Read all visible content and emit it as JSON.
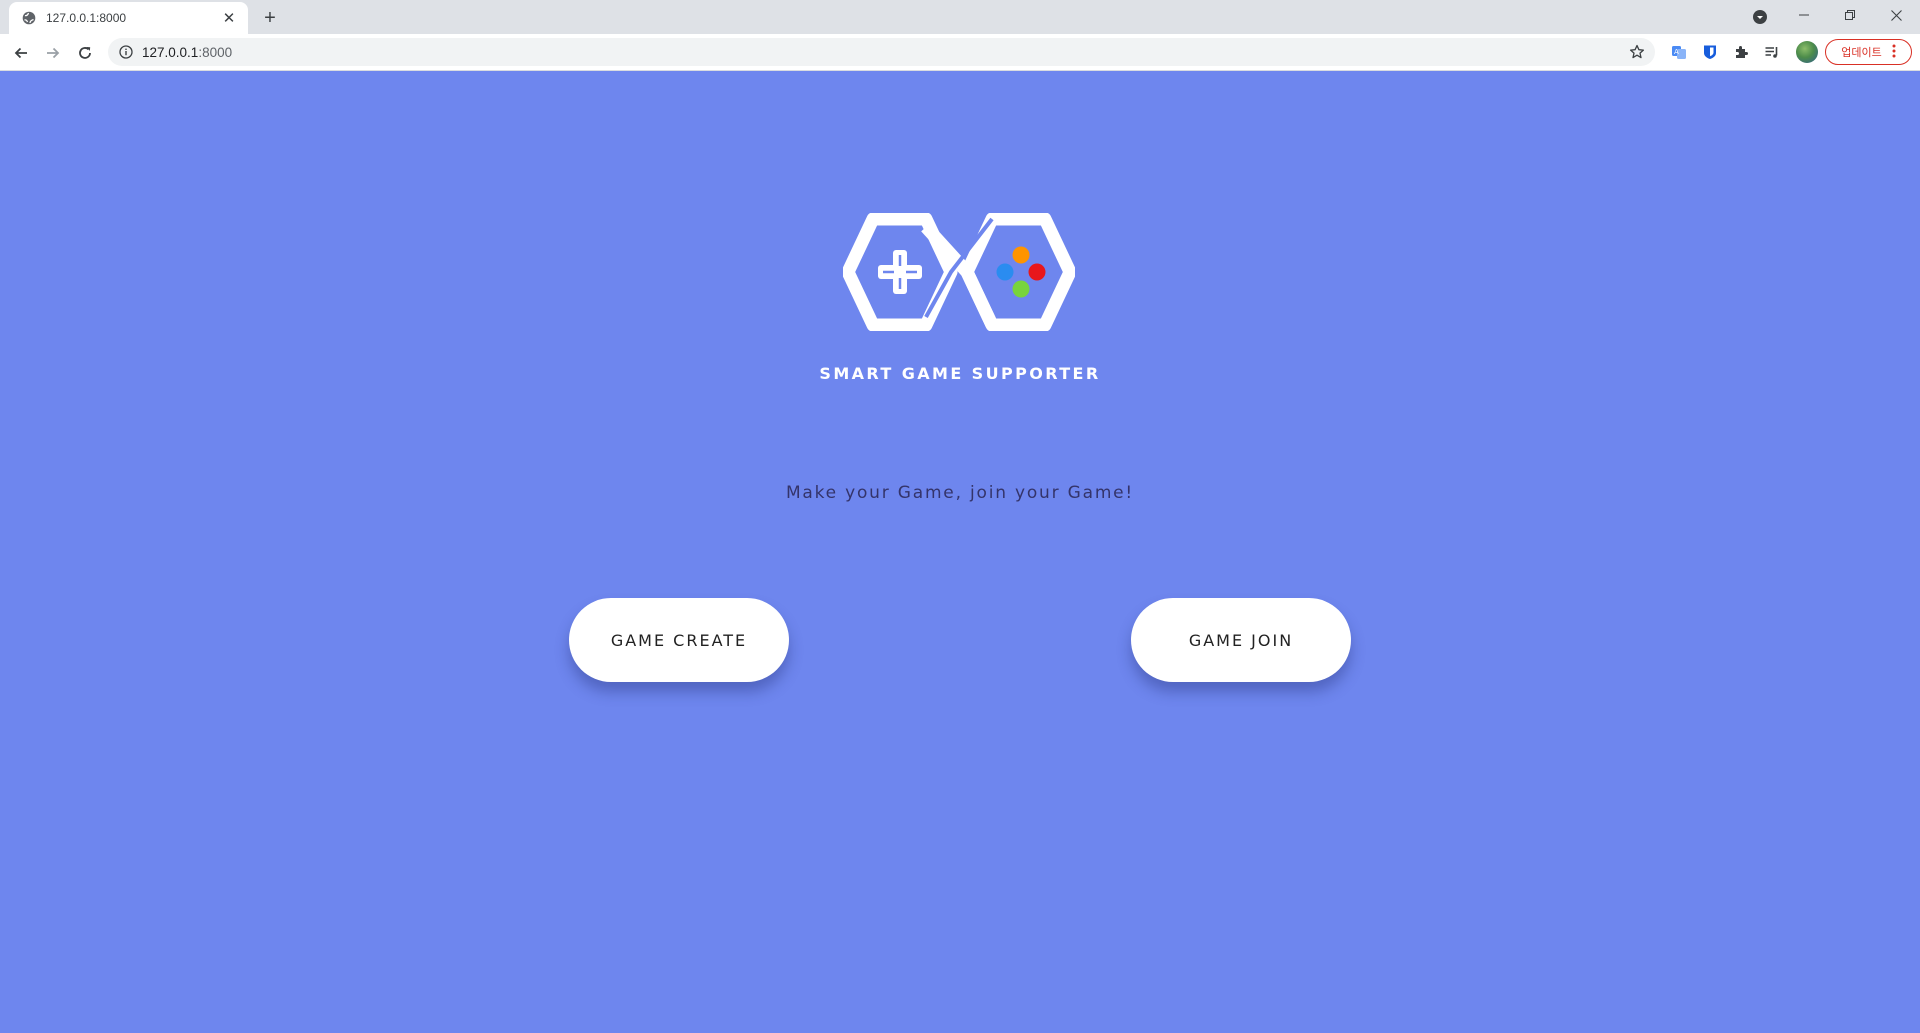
{
  "browser": {
    "tab": {
      "title": "127.0.0.1:8000"
    },
    "address_bar": {
      "host": "127.0.0.1",
      "port": ":8000"
    },
    "update_button": {
      "label": "업데이트"
    }
  },
  "page": {
    "brand_title": "SMART GAME SUPPORTER",
    "tagline": "Make your Game, join your Game!",
    "buttons": {
      "create": "GAME CREATE",
      "join": "GAME JOIN"
    },
    "colors": {
      "background": "#6e86ee",
      "button_orange": "#ff9400",
      "button_red": "#e8171b",
      "button_blue": "#2a8cf0",
      "button_green": "#78d43c"
    }
  }
}
